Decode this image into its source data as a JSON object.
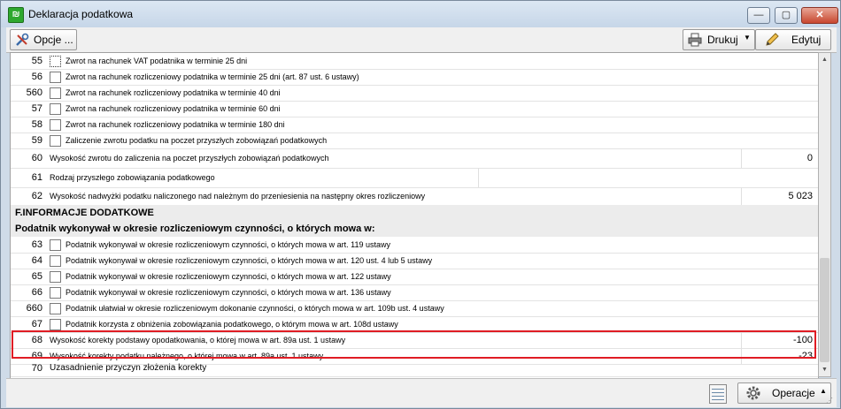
{
  "window": {
    "title": "Deklaracja podatkowa"
  },
  "toolbar": {
    "options_label": "Opcje ...",
    "print_label": "Drukuj",
    "edit_label": "Edytuj"
  },
  "rows": [
    {
      "num": "55",
      "checkbox": true,
      "label": "Zwrot na rachunek VAT podatnika w terminie 25 dni",
      "value": ""
    },
    {
      "num": "56",
      "checkbox": true,
      "label": "Zwrot na rachunek rozliczeniowy podatnika w terminie 25 dni (art. 87 ust. 6 ustawy)",
      "value": ""
    },
    {
      "num": "560",
      "checkbox": true,
      "label": "Zwrot na rachunek rozliczeniowy podatnika w terminie 40 dni",
      "value": ""
    },
    {
      "num": "57",
      "checkbox": true,
      "label": "Zwrot na rachunek rozliczeniowy podatnika w terminie 60 dni",
      "value": ""
    },
    {
      "num": "58",
      "checkbox": true,
      "label": "Zwrot na rachunek rozliczeniowy podatnika w terminie 180 dni",
      "value": ""
    },
    {
      "num": "59",
      "checkbox": true,
      "label": "Zaliczenie zwrotu podatku na poczet przyszłych zobowiązań podatkowych",
      "value": ""
    },
    {
      "num": "60",
      "checkbox": false,
      "label": "Wysokość zwrotu do zaliczenia na poczet przyszłych zobowiązań podatkowych",
      "value": "0"
    },
    {
      "num": "61",
      "checkbox": false,
      "label": "Rodzaj przyszłego zobowiązania podatkowego",
      "value": ""
    },
    {
      "num": "62",
      "checkbox": false,
      "label": "Wysokość nadwyżki podatku naliczonego nad należnym do przeniesienia na następny okres rozliczeniowy",
      "value": "5 023"
    }
  ],
  "section": {
    "title": "F.INFORMACJE DODATKOWE",
    "subtitle": "Podatnik wykonywał w okresie rozliczeniowym czynności, o których mowa w:"
  },
  "rows2": [
    {
      "num": "63",
      "checkbox": true,
      "label": "Podatnik wykonywał w okresie rozliczeniowym czynności, o których mowa w art. 119 ustawy",
      "value": ""
    },
    {
      "num": "64",
      "checkbox": true,
      "label": "Podatnik wykonywał w okresie rozliczeniowym czynności, o których mowa w art. 120 ust. 4 lub 5 ustawy",
      "value": ""
    },
    {
      "num": "65",
      "checkbox": true,
      "label": "Podatnik wykonywał w okresie rozliczeniowym czynności, o których mowa w art. 122 ustawy",
      "value": ""
    },
    {
      "num": "66",
      "checkbox": true,
      "label": "Podatnik wykonywał w okresie rozliczeniowym czynności, o których mowa w art. 136 ustawy",
      "value": ""
    },
    {
      "num": "660",
      "checkbox": true,
      "label": "Podatnik ułatwiał w okresie rozliczeniowym dokonanie czynności, o których mowa w art. 109b ust. 4 ustawy",
      "value": ""
    },
    {
      "num": "67",
      "checkbox": true,
      "label": "Podatnik korzysta z obniżenia zobowiązania podatkowego, o którym mowa w art. 108d ustawy",
      "value": ""
    },
    {
      "num": "68",
      "checkbox": false,
      "label": "Wysokość korekty podstawy opodatkowania, o której mowa w art. 89a ust. 1 ustawy",
      "value": "-100"
    },
    {
      "num": "69",
      "checkbox": false,
      "label": "Wysokość korekty podatku należnego, o której mowa w art. 89a ust. 1 ustawy",
      "value": "-23"
    },
    {
      "num": "70",
      "checkbox": false,
      "label": "Uzasadnienie przyczyn złożenia korekty",
      "value": ""
    }
  ],
  "statusbar": {
    "operations_label": "Operacje"
  },
  "colors": {
    "highlight_border": "#e01c24",
    "section_bg": "#ececec"
  }
}
